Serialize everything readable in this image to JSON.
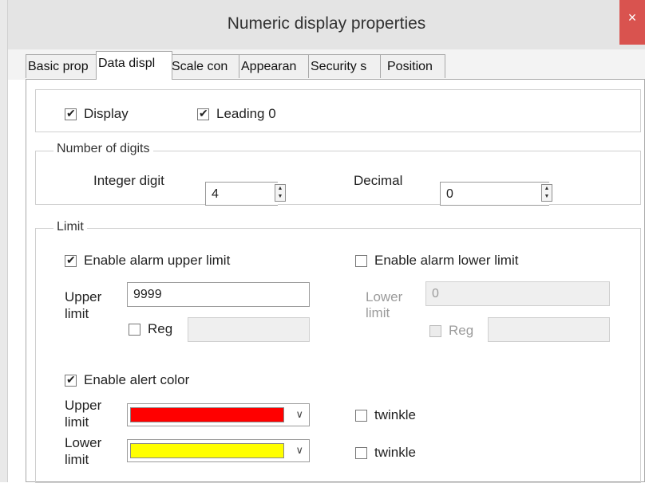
{
  "window": {
    "title": "Numeric display properties",
    "close_glyph": "×"
  },
  "tabs": [
    {
      "label": "Basic prop",
      "active": false
    },
    {
      "label": "Data displ",
      "active": true
    },
    {
      "label": "Scale con",
      "active": false
    },
    {
      "label": "Appearan",
      "active": false
    },
    {
      "label": "Security s",
      "active": false
    },
    {
      "label": "Position",
      "active": false
    }
  ],
  "display": {
    "display_label": "Display",
    "display_checked": true,
    "leading_zero_label": "Leading 0",
    "leading_zero_checked": true
  },
  "digits": {
    "legend": "Number of digits",
    "integer_label": "Integer digit",
    "integer_value": "4",
    "decimal_label": "Decimal",
    "decimal_value": "0"
  },
  "limit": {
    "legend": "Limit",
    "upper": {
      "enable_label": "Enable alarm upper limit",
      "enabled": true,
      "field_label_1": "Upper",
      "field_label_2": "limit",
      "value": "9999",
      "reg_label": "Reg",
      "reg_checked": false
    },
    "lower": {
      "enable_label": "Enable alarm lower limit",
      "enabled": false,
      "field_label_1": "Lower",
      "field_label_2": "limit",
      "value": "0",
      "reg_label": "Reg",
      "reg_checked": false
    },
    "alert": {
      "enable_label": "Enable alert color",
      "enabled": true,
      "upper_label_1": "Upper",
      "upper_label_2": "limit",
      "upper_color": "#ff0000",
      "lower_label_1": "Lower",
      "lower_label_2": "limit",
      "lower_color": "#ffff00",
      "twinkle_label": "twinkle",
      "upper_twinkle": false,
      "lower_twinkle": false,
      "dropdown_glyph": "∨"
    }
  },
  "icons": {
    "checkbox": "checkmark-icon",
    "spinner": "spin-arrows-icon",
    "dropdown": "chevron-down-icon",
    "close": "close-icon"
  }
}
